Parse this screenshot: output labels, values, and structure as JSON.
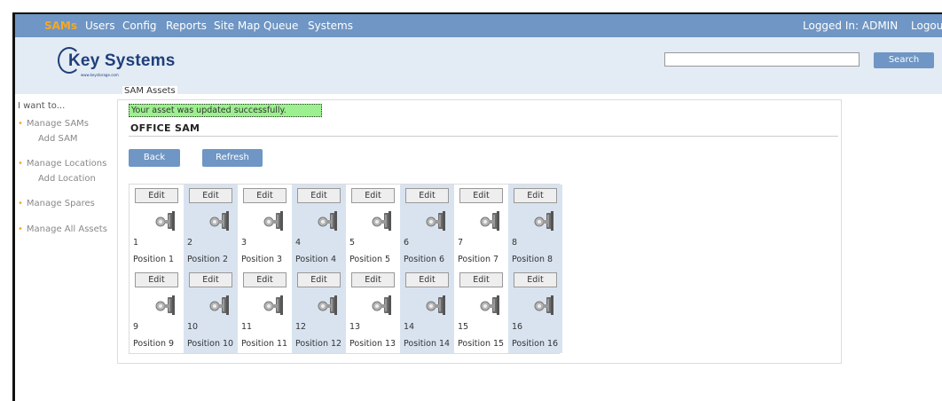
{
  "nav": {
    "items": [
      "SAMs",
      "Users",
      "Config",
      "Reports",
      "Site Map",
      "Queue",
      "Systems"
    ],
    "logged_in": "Logged In: ADMIN",
    "logout": "Logout"
  },
  "header": {
    "logo_main": "Key Systems",
    "logo_sub": "www.keystorage.com",
    "search_value": "",
    "search_button": "Search"
  },
  "sidebar": {
    "title": "I want to...",
    "manage_sams": "Manage SAMs",
    "add_sam": "Add SAM",
    "manage_locations": "Manage Locations",
    "add_location": "Add Location",
    "manage_spares": "Manage Spares",
    "manage_all_assets": "Manage All Assets"
  },
  "content": {
    "legend": "SAM Assets",
    "success_message": "Your asset was updated successfully.",
    "sam_name": "OFFICE SAM",
    "back_button": "Back",
    "refresh_button": "Refresh",
    "edit_label": "Edit",
    "positions": [
      {
        "num": "1",
        "label": "Position 1"
      },
      {
        "num": "2",
        "label": "Position 2"
      },
      {
        "num": "3",
        "label": "Position 3"
      },
      {
        "num": "4",
        "label": "Position 4"
      },
      {
        "num": "5",
        "label": "Position 5"
      },
      {
        "num": "6",
        "label": "Position 6"
      },
      {
        "num": "7",
        "label": "Position 7"
      },
      {
        "num": "8",
        "label": "Position 8"
      },
      {
        "num": "9",
        "label": "Position 9"
      },
      {
        "num": "10",
        "label": "Position 10"
      },
      {
        "num": "11",
        "label": "Position 11"
      },
      {
        "num": "12",
        "label": "Position 12"
      },
      {
        "num": "13",
        "label": "Position 13"
      },
      {
        "num": "14",
        "label": "Position 14"
      },
      {
        "num": "15",
        "label": "Position 15"
      },
      {
        "num": "16",
        "label": "Position 16"
      }
    ]
  },
  "colors": {
    "nav_bg": "#6f96c4",
    "active_nav": "#f6a923",
    "header_bg": "#e3ebf5",
    "success_bg": "#9df08f",
    "alt_cell_bg": "#d9e3f0"
  }
}
